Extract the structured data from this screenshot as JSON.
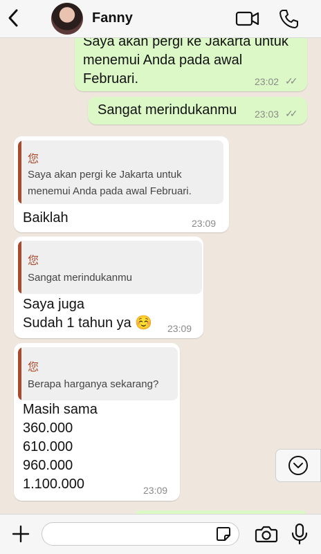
{
  "header": {
    "contact_name": "Fanny",
    "back_icon": "chevron-left-icon",
    "video_icon": "video-camera-icon",
    "call_icon": "phone-icon"
  },
  "messages": [
    {
      "direction": "out",
      "lines": [
        "Saya akan pergi ke Jakarta untuk",
        "menemui Anda pada awal",
        "Februari."
      ],
      "time": "23:02",
      "ticks": "✓✓"
    },
    {
      "direction": "out",
      "lines": [
        "Sangat merindukanmu"
      ],
      "time": "23:03",
      "ticks": "✓✓"
    },
    {
      "direction": "in",
      "quote": {
        "author": "您",
        "lines": [
          "Saya akan pergi ke Jakarta untuk",
          "menemui Anda pada awal Februari."
        ]
      },
      "lines": [
        "Baiklah"
      ],
      "time": "23:09"
    },
    {
      "direction": "in",
      "quote": {
        "author": "您",
        "lines": [
          "Sangat merindukanmu"
        ]
      },
      "lines": [
        "Saya juga",
        "Sudah 1 tahun ya ☺️"
      ],
      "time": "23:09"
    },
    {
      "direction": "in",
      "quote": {
        "author": "您",
        "lines": [
          "Berapa harganya sekarang?"
        ]
      },
      "lines": [
        "Masih sama",
        "360.000",
        "610.000",
        "960.000",
        "1.100.000"
      ],
      "time": "23:09"
    }
  ],
  "scroll_down_icon": "chevron-down-circle-icon",
  "footer": {
    "input_value": "",
    "input_placeholder": "",
    "add_icon": "plus-icon",
    "sticker_icon": "sticker-icon",
    "camera_icon": "camera-icon",
    "mic_icon": "microphone-icon"
  },
  "colors": {
    "outgoing_bubble": "#dcf8c6",
    "incoming_bubble": "#ffffff",
    "quote_accent": "#a94a2c",
    "chat_background": "#efe7dd",
    "read_ticks": "#8a8a8a"
  }
}
